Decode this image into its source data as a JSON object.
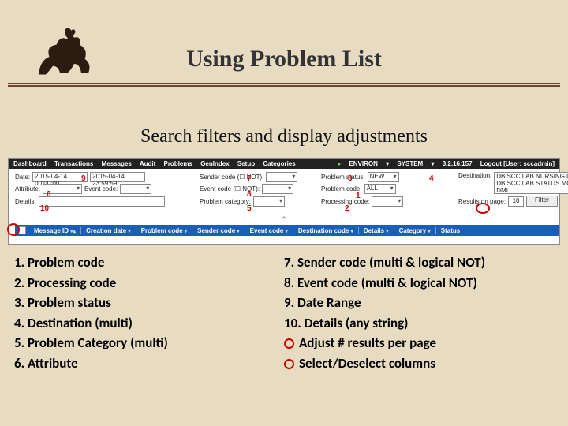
{
  "title": "Using Problem List",
  "subtitle": "Search filters and display adjustments",
  "menubar": {
    "left": [
      "Dashboard",
      "Transactions",
      "Messages",
      "Audit",
      "Problems",
      "GenIndex",
      "Setup",
      "Categories"
    ],
    "right_env": "ENVIRON",
    "right_system": "SYSTEM",
    "right_ip": "3.2.16.157",
    "right_logout": "Logout [User: sccadmin]"
  },
  "filters": {
    "date_label": "Date:",
    "date_from": "2015-04-14 00:00:00",
    "date_to": "2015-04-14 23:59:59",
    "attribute_label": "Attribute:",
    "attribute_value": "",
    "event_label": "Event code:",
    "event_value": "",
    "details_label": "Details:",
    "details_value": "",
    "sender_label": "Sender code (☐ NOT):",
    "sender_value": "",
    "eventcode_label": "Event code (☐ NOT):",
    "eventcode_value": "",
    "category_label": "Problem category:",
    "category_value": "",
    "problem_label": "Problem status:",
    "problem_value": "NEW",
    "problemcode_label": "Problem code:",
    "problemcode_value": "ALL",
    "processing_label": "Processing code:",
    "processing_value": "",
    "destination_label": "Destination:",
    "destination_items": [
      "DB.SCC.LAB.NURSING.ORDER.ENTRY",
      "DB.SCC.LAB.STATUS.MONITOR",
      "DMI"
    ],
    "results_label": "Results on page:",
    "results_value": "10",
    "filter_btn": "Filter"
  },
  "columns": [
    "Message ID",
    "Creation date",
    "Problem code",
    "Sender code",
    "Event code",
    "Destination code",
    "Details",
    "Category",
    "Status"
  ],
  "callouts": {
    "c1": "1",
    "c2": "2",
    "c3": "3",
    "c4": "4",
    "c5": "5",
    "c6": "6",
    "c7": "7",
    "c8": "8",
    "c9": "9",
    "c10": "10"
  },
  "legend_left": [
    "1. Problem code",
    "2. Processing code",
    "3. Problem status",
    "4. Destination (multi)",
    "5. Problem Category (multi)",
    "6. Attribute"
  ],
  "legend_right": [
    "7. Sender code (multi & logical NOT)",
    "8. Event code (multi & logical NOT)",
    "9. Date Range",
    "10. Details (any string)",
    "Adjust # results per page",
    "Select/Deselect columns"
  ]
}
